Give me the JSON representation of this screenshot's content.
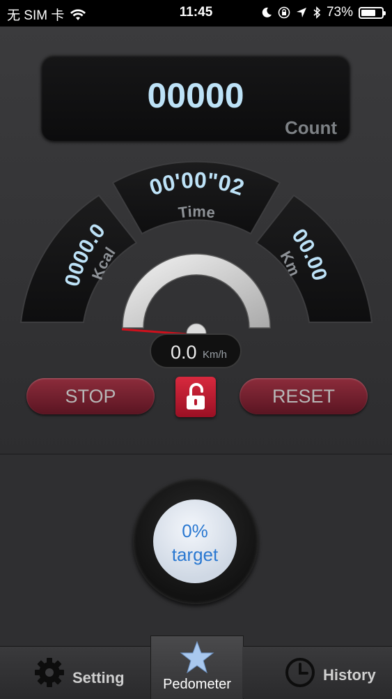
{
  "status_bar": {
    "carrier": "无 SIM 卡",
    "time": "11:45",
    "battery_percent": "73%",
    "battery_level": 0.73
  },
  "counter": {
    "value": "00000",
    "label": "Count"
  },
  "metrics": {
    "time_value": "00'00\"02",
    "time_label": "Time",
    "kcal_value": "0000.0",
    "kcal_label": "Kcal",
    "km_value": "00.00",
    "km_label": "Km"
  },
  "speed": {
    "value": "0.0",
    "unit": "Km/h"
  },
  "controls": {
    "stop_label": "STOP",
    "reset_label": "RESET"
  },
  "target": {
    "percent": "0%",
    "label": "target"
  },
  "tabs": [
    {
      "label": "Setting",
      "icon": "gear-icon"
    },
    {
      "label": "Pedometer",
      "icon": "star-icon"
    },
    {
      "label": "History",
      "icon": "clock-icon"
    }
  ],
  "colors": {
    "accent_blue": "#bde2f7",
    "button_red": "#8c2c3b",
    "target_blue": "#2a78d1"
  }
}
